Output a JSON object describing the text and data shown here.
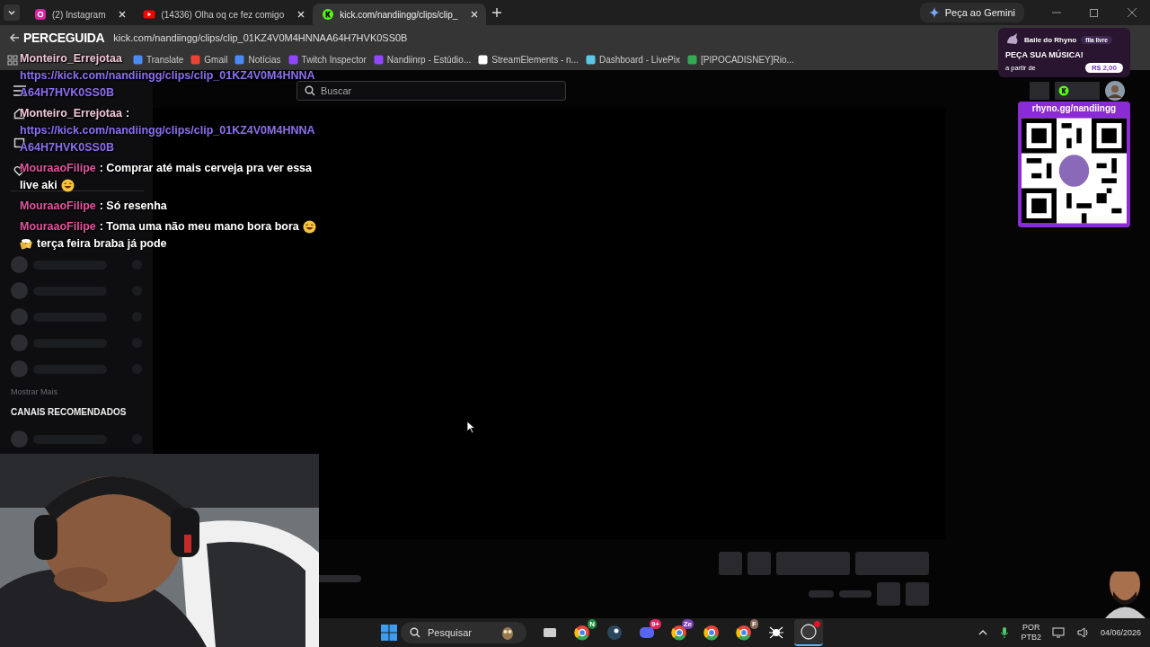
{
  "browser": {
    "tabs": [
      {
        "title": "(2) Instagram",
        "kind": "instagram",
        "selected": false
      },
      {
        "title": "(14336) Olha oq ce fez comigo",
        "kind": "youtube",
        "selected": false
      },
      {
        "title": "kick.com/nandiingg/clips/clip_",
        "kind": "kick",
        "selected": true
      }
    ],
    "gemini_button": "Peça ao Gemini",
    "address": "kick.com/nandiingg/clips/clip_01KZ4V0M4HNNAA64H7HVK0SS0B",
    "bookmarks": [
      {
        "label": "Translate",
        "kind": "translate"
      },
      {
        "label": "Gmail",
        "kind": "gmail"
      },
      {
        "label": "Notícias",
        "kind": "news"
      },
      {
        "label": "Twitch Inspector",
        "kind": "twitch"
      },
      {
        "label": "Nandiinrp - Estúdio...",
        "kind": "twitch"
      },
      {
        "label": "StreamElements - n...",
        "kind": "streamelements"
      },
      {
        "label": "Dashboard - LivePix",
        "kind": "livepix"
      },
      {
        "label": "[PIPOCADISNEY]Rio...",
        "kind": "drive"
      }
    ]
  },
  "stream_title": "PERCEGUIDA",
  "kick": {
    "search_placeholder": "Buscar",
    "nav": [
      {
        "kind": "home"
      },
      {
        "kind": "browse"
      },
      {
        "kind": "heart"
      }
    ],
    "show_more": "Mostrar Mais",
    "recommended_heading": "CANAIS RECOMENDADOS"
  },
  "chat": [
    {
      "user": "Monteiro_Errejotaa",
      "color": "#f2c6d8",
      "segments": [
        {
          "kind": "link",
          "text": "https://kick.com/nandiingg/clips/clip_01KZ4V0M4HNNAA64H7HVK0SS0B"
        }
      ]
    },
    {
      "user": "Monteiro_Errejotaa",
      "color": "#f2c6d8",
      "segments": [
        {
          "kind": "text",
          "text": ":"
        },
        {
          "kind": "link",
          "text": "https://kick.com/nandiingg/clips/clip_01KZ4V0M4HNNAA64H7HVK0SS0B"
        }
      ]
    },
    {
      "user": "MouraaoFilipe",
      "color": "#e0559e",
      "segments": [
        {
          "kind": "text",
          "text": ": Comprar até mais cerveja pra ver essa"
        },
        {
          "kind": "break"
        },
        {
          "kind": "text",
          "text": "live aki"
        },
        {
          "kind": "laugh"
        }
      ]
    },
    {
      "user": "MouraaoFilipe",
      "color": "#e0559e",
      "segments": [
        {
          "kind": "text",
          "text": ": Só resenha"
        }
      ]
    },
    {
      "user": "MouraaoFilipe",
      "color": "#e0559e",
      "segments": [
        {
          "kind": "text",
          "text": ": Toma uma não meu mano bora bora"
        },
        {
          "kind": "laugh"
        },
        {
          "kind": "break"
        },
        {
          "kind": "beer"
        },
        {
          "kind": "text",
          "text": "terça feira braba já pode"
        }
      ]
    }
  ],
  "song_widget": {
    "name": "Baile do Rhyno",
    "badge": "fila livre",
    "headline": "PEÇA SUA MÚSICA!",
    "price_label": "a partir de",
    "price": "R$ 2,00"
  },
  "qr_card": {
    "url": "rhyno.gg/nandiingg"
  },
  "taskbar": {
    "search_placeholder": "Pesquisar",
    "apps": [
      {
        "kind": "taskview",
        "active": false
      },
      {
        "kind": "chrome",
        "badge": "N",
        "active": false
      },
      {
        "kind": "steam",
        "active": false
      },
      {
        "kind": "discord",
        "badge": "9+",
        "active": false
      },
      {
        "kind": "chrome",
        "badge": "Ze",
        "active": false
      },
      {
        "kind": "chrome",
        "active": false
      },
      {
        "kind": "chrome",
        "badge": "F",
        "active": false
      },
      {
        "kind": "spider",
        "active": false
      },
      {
        "kind": "obs",
        "active": true
      }
    ],
    "language": "POR",
    "layout": "PTB2",
    "date": "04/06/2026"
  }
}
